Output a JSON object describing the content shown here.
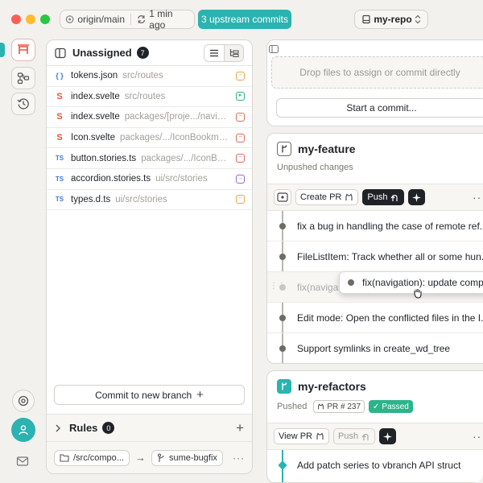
{
  "colors": {
    "accent": "#2ab3b0",
    "close": "#ff5f57",
    "minimize": "#febc2e",
    "zoom": "#28c840",
    "passed": "#2bb48a",
    "dark_button": "#1f2328"
  },
  "titlebar": {
    "branch": "origin/main",
    "last_fetch": "1 min ago",
    "upstream_button": "3 upstream commits",
    "repo_name": "my-repo"
  },
  "sidebar": {
    "items": [
      {
        "icon": "workspace-icon",
        "active": true
      },
      {
        "icon": "branches-icon",
        "active": false
      },
      {
        "icon": "history-icon",
        "active": false
      }
    ],
    "bottom": [
      {
        "icon": "settings-icon"
      },
      {
        "icon": "user-avatar"
      },
      {
        "icon": "mail-icon"
      }
    ]
  },
  "unassigned": {
    "title": "Unassigned",
    "count": "7",
    "files": [
      {
        "icon": "{ }",
        "type": "json",
        "name": "tokens.json",
        "path": "src/routes",
        "status": "modified"
      },
      {
        "icon": "S",
        "type": "svelte",
        "name": "index.svelte",
        "path": "src/routes",
        "status": "added"
      },
      {
        "icon": "S",
        "type": "svelte",
        "name": "index.svelte",
        "path": "packages/[proje.../navigati...",
        "status": "deleted"
      },
      {
        "icon": "S",
        "type": "svelte",
        "name": "Icon.svelte",
        "path": "packages/.../IconBookmark...",
        "status": "deleted"
      },
      {
        "icon": "TS",
        "type": "ts",
        "name": "button.stories.ts",
        "path": "packages/.../IconBook...",
        "status": "deleted"
      },
      {
        "icon": "TS",
        "type": "ts",
        "name": "accordion.stories.ts",
        "path": "ui/src/stories",
        "status": "renamed"
      },
      {
        "icon": "TS",
        "type": "ts",
        "name": "types.d.ts",
        "path": "ui/src/stories",
        "status": "modified"
      }
    ],
    "commit_new_branch": "Commit to new branch",
    "rules_label": "Rules",
    "rules_count": "0",
    "rule": {
      "path": "/src/compo...",
      "branch": "sume-bugfix"
    }
  },
  "drop_zone": {
    "placeholder": "Drop files to assign or commit directly",
    "start_commit": "Start a commit..."
  },
  "branches": [
    {
      "name": "my-feature",
      "subtitle": "Unpushed changes",
      "buttons": {
        "create_pr": "Create PR",
        "push": "Push"
      },
      "commits": [
        "fix a bug in handling the case of remote ref.",
        "FileListItem: Track whether all or some hun.",
        "fix(naviga",
        "Edit mode: Open the conflicted files in the I.",
        "Support symlinks in create_wd_tree"
      ]
    },
    {
      "name": "my-refactors",
      "subtitle": "Pushed",
      "pr_label": "PR # 237",
      "ci_status": "Passed",
      "buttons": {
        "view_pr": "View PR",
        "push": "Push"
      },
      "commits": [
        "Add patch series to vbranch API struct"
      ]
    }
  ],
  "dragged_commit": "fix(navigation): update comp"
}
